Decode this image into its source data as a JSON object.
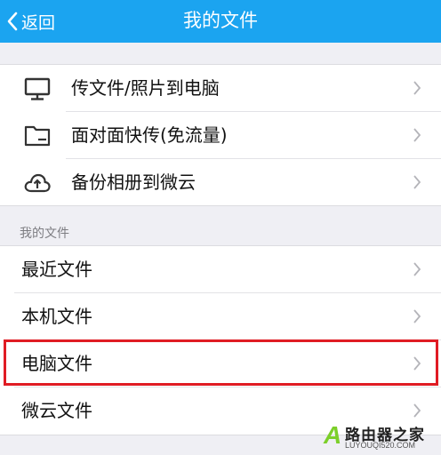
{
  "header": {
    "back_label": "返回",
    "title": "我的文件",
    "color": "#1ba4f0"
  },
  "actions": [
    {
      "label": "传文件/照片到电脑",
      "icon": "monitor-icon"
    },
    {
      "label": "面对面快传(免流量)",
      "icon": "folder-icon"
    },
    {
      "label": "备份相册到微云",
      "icon": "cloud-upload-icon"
    }
  ],
  "my_files": {
    "section_label": "我的文件",
    "items": [
      {
        "label": "最近文件"
      },
      {
        "label": "本机文件"
      },
      {
        "label": "电脑文件"
      },
      {
        "label": "微云文件"
      }
    ]
  },
  "highlight_color": "#e01c24",
  "watermark": {
    "title": "路由器之家",
    "subtitle": "LUYOUQI520.COM",
    "badge": "A"
  }
}
